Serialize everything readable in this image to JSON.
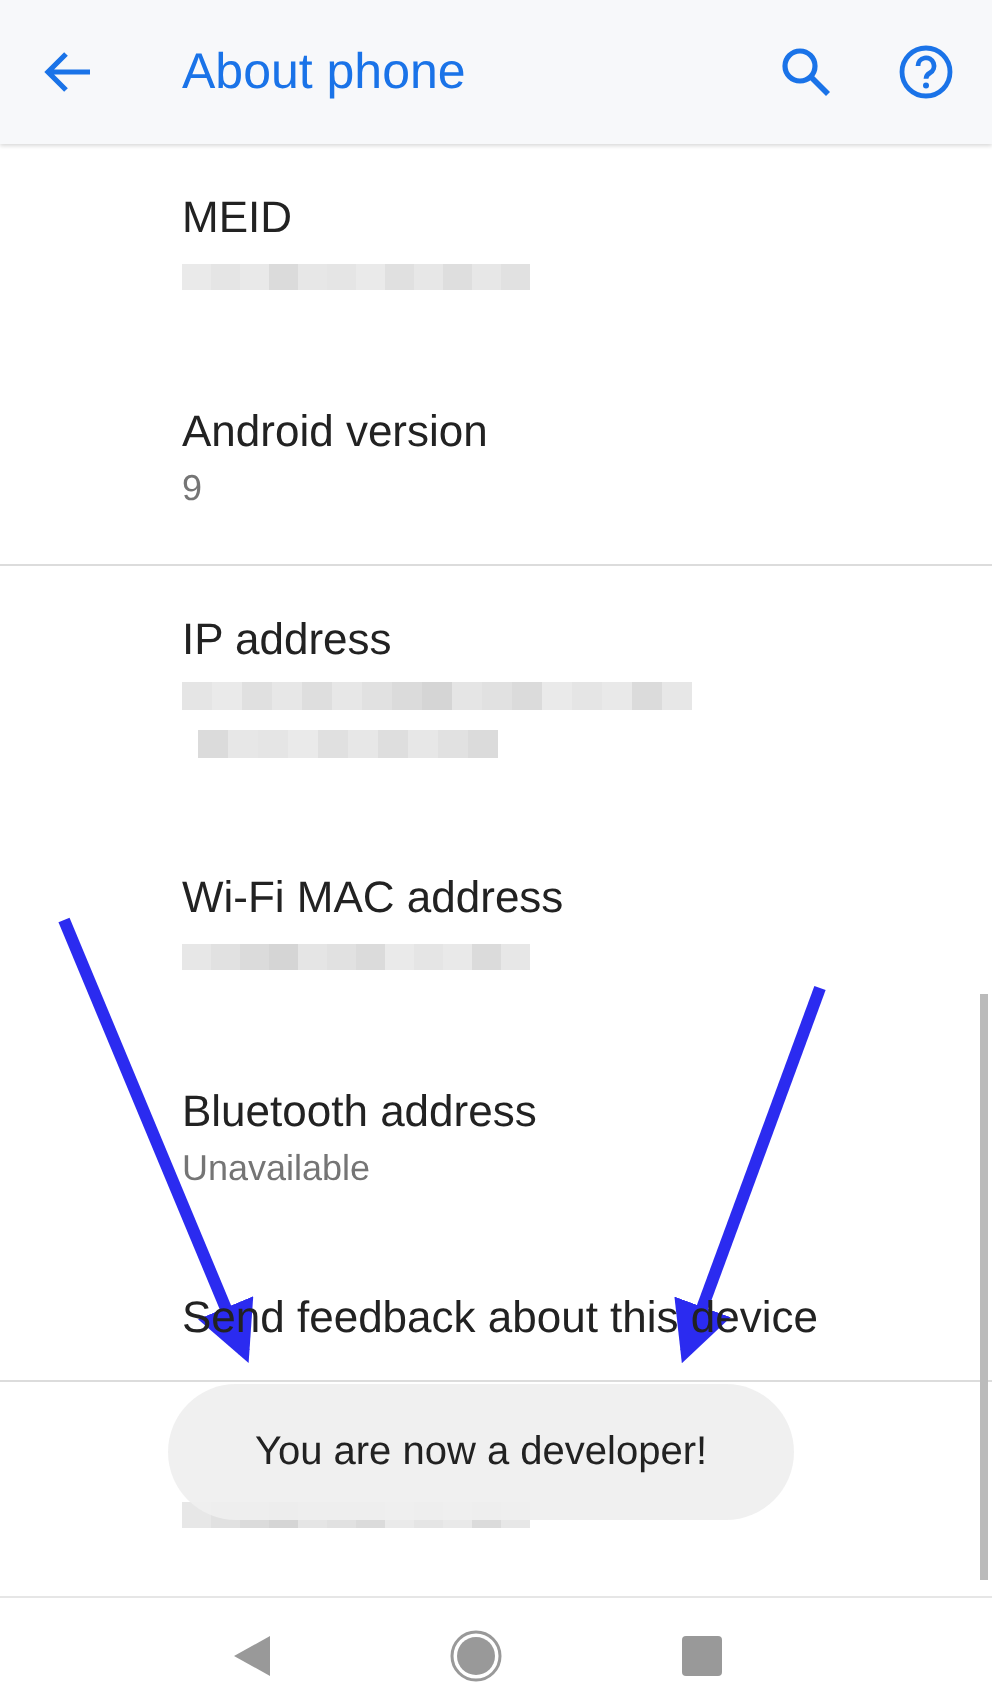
{
  "app_bar": {
    "title": "About phone"
  },
  "sections": [
    {
      "items": [
        {
          "title": "MEID",
          "kind": "blurred"
        },
        {
          "title": "Android version",
          "kind": "text",
          "summary": "9"
        }
      ]
    },
    {
      "items": [
        {
          "title": "IP address",
          "kind": "blurred-tall"
        },
        {
          "title": "Wi-Fi MAC address",
          "kind": "blurred"
        },
        {
          "title": "Bluetooth address",
          "kind": "text",
          "summary": "Unavailable"
        },
        {
          "title": "Send feedback about this device",
          "kind": "title-only"
        }
      ]
    },
    {
      "items": [
        {
          "kind": "blurred"
        }
      ]
    }
  ],
  "toast": {
    "text": "You are now a developer!"
  }
}
